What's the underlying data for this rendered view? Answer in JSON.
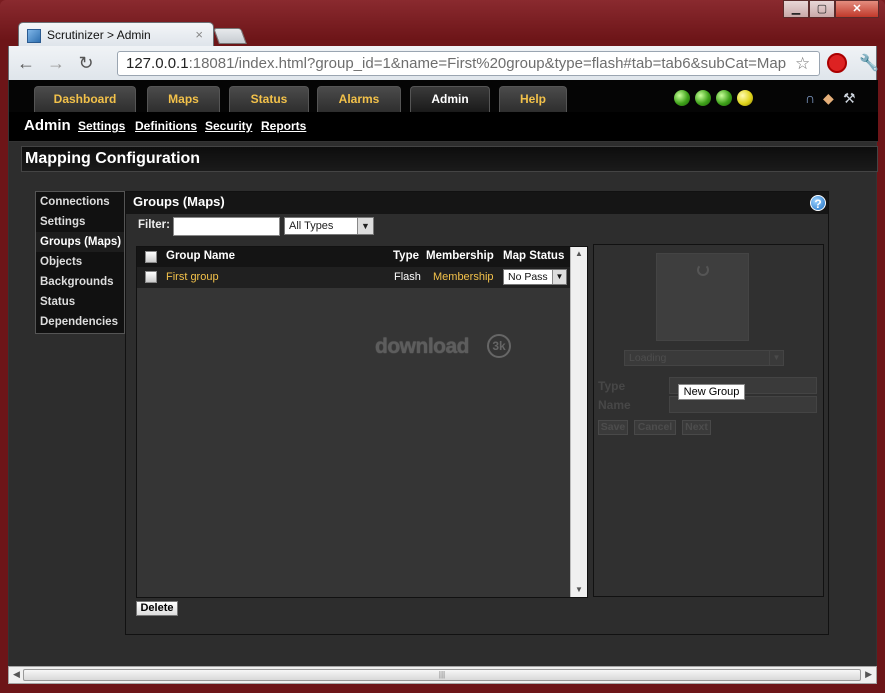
{
  "browser": {
    "tab_title": "Scrutinizer > Admin",
    "tab_close": "×",
    "url_host": "127.0.0.1",
    "url_rest": ":18081/index.html?group_id=1&name=First%20group&type=flash#tab=tab6&subCat=Map"
  },
  "topnav": {
    "tabs": [
      "Dashboard",
      "Maps",
      "Status",
      "Alarms",
      "Admin",
      "Help"
    ],
    "active": "Admin",
    "status_orbs": [
      "green",
      "green",
      "green",
      "yellow"
    ]
  },
  "subnav": {
    "section": "Admin",
    "links": [
      "Settings",
      "Definitions",
      "Security",
      "Reports"
    ]
  },
  "panel_title": "Mapping Configuration",
  "sidebar": {
    "items": [
      "Connections",
      "Settings",
      "Groups (Maps)",
      "Objects",
      "Backgrounds",
      "Status",
      "Dependencies"
    ],
    "active": "Groups (Maps)"
  },
  "groups": {
    "heading": "Groups (Maps)",
    "help": "?",
    "filter_label": "Filter:",
    "filter_value": "",
    "type_filter": "All Types",
    "columns": {
      "name": "Group Name",
      "type": "Type",
      "membership": "Membership",
      "map_status": "Map Status"
    },
    "rows": [
      {
        "name": "First group",
        "type": "Flash",
        "membership": "Membership",
        "map_status": "No Pass"
      }
    ],
    "delete_label": "Delete"
  },
  "watermark": {
    "text": "download",
    "badge": "3k"
  },
  "editor": {
    "loading": "Loading",
    "type_label": "Type",
    "name_label": "Name",
    "new_group": "New Group",
    "save": "Save",
    "cancel": "Cancel",
    "next": "Next"
  },
  "colors": {
    "accent": "#f2c14a",
    "row_link": "#f2c14a",
    "background": "#2d2d2d"
  }
}
